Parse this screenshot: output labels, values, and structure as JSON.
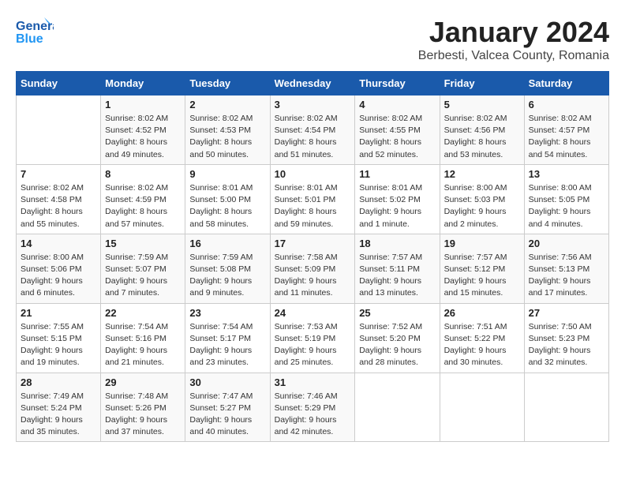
{
  "logo": {
    "line1": "General",
    "line2": "Blue"
  },
  "title": "January 2024",
  "subtitle": "Berbesti, Valcea County, Romania",
  "days_header": [
    "Sunday",
    "Monday",
    "Tuesday",
    "Wednesday",
    "Thursday",
    "Friday",
    "Saturday"
  ],
  "weeks": [
    [
      {
        "num": "",
        "info": ""
      },
      {
        "num": "1",
        "info": "Sunrise: 8:02 AM\nSunset: 4:52 PM\nDaylight: 8 hours\nand 49 minutes."
      },
      {
        "num": "2",
        "info": "Sunrise: 8:02 AM\nSunset: 4:53 PM\nDaylight: 8 hours\nand 50 minutes."
      },
      {
        "num": "3",
        "info": "Sunrise: 8:02 AM\nSunset: 4:54 PM\nDaylight: 8 hours\nand 51 minutes."
      },
      {
        "num": "4",
        "info": "Sunrise: 8:02 AM\nSunset: 4:55 PM\nDaylight: 8 hours\nand 52 minutes."
      },
      {
        "num": "5",
        "info": "Sunrise: 8:02 AM\nSunset: 4:56 PM\nDaylight: 8 hours\nand 53 minutes."
      },
      {
        "num": "6",
        "info": "Sunrise: 8:02 AM\nSunset: 4:57 PM\nDaylight: 8 hours\nand 54 minutes."
      }
    ],
    [
      {
        "num": "7",
        "info": "Sunrise: 8:02 AM\nSunset: 4:58 PM\nDaylight: 8 hours\nand 55 minutes."
      },
      {
        "num": "8",
        "info": "Sunrise: 8:02 AM\nSunset: 4:59 PM\nDaylight: 8 hours\nand 57 minutes."
      },
      {
        "num": "9",
        "info": "Sunrise: 8:01 AM\nSunset: 5:00 PM\nDaylight: 8 hours\nand 58 minutes."
      },
      {
        "num": "10",
        "info": "Sunrise: 8:01 AM\nSunset: 5:01 PM\nDaylight: 8 hours\nand 59 minutes."
      },
      {
        "num": "11",
        "info": "Sunrise: 8:01 AM\nSunset: 5:02 PM\nDaylight: 9 hours\nand 1 minute."
      },
      {
        "num": "12",
        "info": "Sunrise: 8:00 AM\nSunset: 5:03 PM\nDaylight: 9 hours\nand 2 minutes."
      },
      {
        "num": "13",
        "info": "Sunrise: 8:00 AM\nSunset: 5:05 PM\nDaylight: 9 hours\nand 4 minutes."
      }
    ],
    [
      {
        "num": "14",
        "info": "Sunrise: 8:00 AM\nSunset: 5:06 PM\nDaylight: 9 hours\nand 6 minutes."
      },
      {
        "num": "15",
        "info": "Sunrise: 7:59 AM\nSunset: 5:07 PM\nDaylight: 9 hours\nand 7 minutes."
      },
      {
        "num": "16",
        "info": "Sunrise: 7:59 AM\nSunset: 5:08 PM\nDaylight: 9 hours\nand 9 minutes."
      },
      {
        "num": "17",
        "info": "Sunrise: 7:58 AM\nSunset: 5:09 PM\nDaylight: 9 hours\nand 11 minutes."
      },
      {
        "num": "18",
        "info": "Sunrise: 7:57 AM\nSunset: 5:11 PM\nDaylight: 9 hours\nand 13 minutes."
      },
      {
        "num": "19",
        "info": "Sunrise: 7:57 AM\nSunset: 5:12 PM\nDaylight: 9 hours\nand 15 minutes."
      },
      {
        "num": "20",
        "info": "Sunrise: 7:56 AM\nSunset: 5:13 PM\nDaylight: 9 hours\nand 17 minutes."
      }
    ],
    [
      {
        "num": "21",
        "info": "Sunrise: 7:55 AM\nSunset: 5:15 PM\nDaylight: 9 hours\nand 19 minutes."
      },
      {
        "num": "22",
        "info": "Sunrise: 7:54 AM\nSunset: 5:16 PM\nDaylight: 9 hours\nand 21 minutes."
      },
      {
        "num": "23",
        "info": "Sunrise: 7:54 AM\nSunset: 5:17 PM\nDaylight: 9 hours\nand 23 minutes."
      },
      {
        "num": "24",
        "info": "Sunrise: 7:53 AM\nSunset: 5:19 PM\nDaylight: 9 hours\nand 25 minutes."
      },
      {
        "num": "25",
        "info": "Sunrise: 7:52 AM\nSunset: 5:20 PM\nDaylight: 9 hours\nand 28 minutes."
      },
      {
        "num": "26",
        "info": "Sunrise: 7:51 AM\nSunset: 5:22 PM\nDaylight: 9 hours\nand 30 minutes."
      },
      {
        "num": "27",
        "info": "Sunrise: 7:50 AM\nSunset: 5:23 PM\nDaylight: 9 hours\nand 32 minutes."
      }
    ],
    [
      {
        "num": "28",
        "info": "Sunrise: 7:49 AM\nSunset: 5:24 PM\nDaylight: 9 hours\nand 35 minutes."
      },
      {
        "num": "29",
        "info": "Sunrise: 7:48 AM\nSunset: 5:26 PM\nDaylight: 9 hours\nand 37 minutes."
      },
      {
        "num": "30",
        "info": "Sunrise: 7:47 AM\nSunset: 5:27 PM\nDaylight: 9 hours\nand 40 minutes."
      },
      {
        "num": "31",
        "info": "Sunrise: 7:46 AM\nSunset: 5:29 PM\nDaylight: 9 hours\nand 42 minutes."
      },
      {
        "num": "",
        "info": ""
      },
      {
        "num": "",
        "info": ""
      },
      {
        "num": "",
        "info": ""
      }
    ]
  ]
}
